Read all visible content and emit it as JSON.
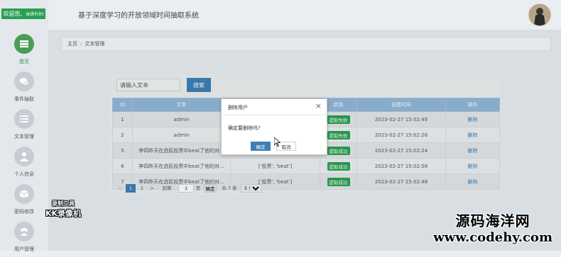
{
  "app": {
    "title": "基于深度学习的开放领域时间抽取系统",
    "welcome": "欢迎您、admin"
  },
  "sidebar": {
    "items": [
      {
        "label": "首页",
        "icon": "home-icon"
      },
      {
        "label": "事件抽取",
        "icon": "chat-icon"
      },
      {
        "label": "文本管理",
        "icon": "list-icon"
      },
      {
        "label": "个人信息",
        "icon": "person-icon"
      },
      {
        "label": "密码修改",
        "icon": "cube-icon"
      },
      {
        "label": "用户管理",
        "icon": "users-icon"
      }
    ]
  },
  "breadcrumb": {
    "home": "主页",
    "current": "文本管理"
  },
  "search": {
    "placeholder": "请输入文本",
    "button": "搜索"
  },
  "table": {
    "headers": [
      "ID",
      "文本",
      "",
      "状态",
      "创建时间",
      "操作"
    ],
    "rows": [
      {
        "id": "1",
        "text": "admin",
        "result": "",
        "status": "提取失败",
        "time": "2023-02-27 15:02:49",
        "action": "删除"
      },
      {
        "id": "2",
        "text": "admin",
        "result": "",
        "status": "提取失败",
        "time": "2023-02-27 15:02:26",
        "action": "删除"
      },
      {
        "id": "5",
        "text": "李四昨天在选民投票中beat了他的对...",
        "result": "",
        "status": "提取成功",
        "time": "2023-02-27 15:02:24",
        "action": "删除"
      },
      {
        "id": "6",
        "text": "李四昨天在选民投票中beat了他的对...",
        "result": "['投票', 'beat']",
        "status": "提取成功",
        "time": "2023-02-27 15:02:58",
        "action": "删除"
      },
      {
        "id": "7",
        "text": "李四昨天在选民投票中beat了他的对...",
        "result": "['投票', 'beat']",
        "status": "提取成功",
        "time": "2023-02-27 15:02:48",
        "action": "删除"
      }
    ]
  },
  "pagination": {
    "prev": "<",
    "pages": [
      "1",
      "2"
    ],
    "next": ">",
    "goto_label": "到第",
    "goto_value": "1",
    "page_unit": "页",
    "confirm": "确定",
    "total": "共 7 条",
    "page_size": "5 条/页"
  },
  "dialog": {
    "title": "删除用户",
    "message": "确定要删除吗?",
    "ok": "确定",
    "cancel": "取消",
    "close": "×"
  },
  "watermarks": {
    "rec_line1": "录制工具",
    "rec_line2": "KK录像机",
    "site_line1": "源码海洋网",
    "site_line2": "www.codehy.com"
  },
  "colors": {
    "accent": "#3b7fb7",
    "success": "#2aa052",
    "table_header": "#92b8d9"
  }
}
